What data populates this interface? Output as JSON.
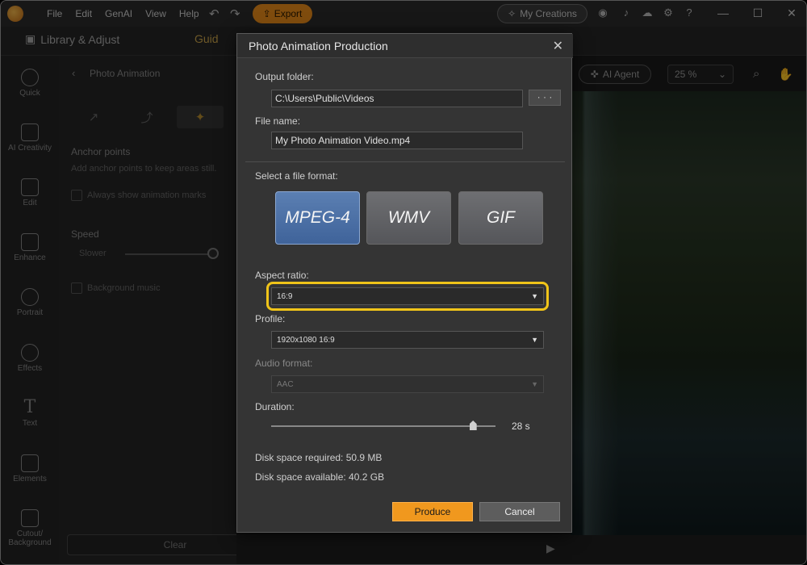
{
  "app": {
    "menu": [
      "File",
      "Edit",
      "GenAI",
      "View",
      "Help"
    ],
    "export_label": "Export",
    "my_creations_label": "My Creations",
    "library_tab": "Library & Adjust",
    "guide_tab": "Guid",
    "ai_agent_label": "AI Agent",
    "zoom_value": "25 %"
  },
  "sidebar": {
    "items": [
      {
        "label": "Quick",
        "icon": "magic-wand-icon"
      },
      {
        "label": "AI Creativity",
        "icon": "ai-creativity-icon"
      },
      {
        "label": "Edit",
        "icon": "edit-icon"
      },
      {
        "label": "Enhance",
        "icon": "enhance-icon"
      },
      {
        "label": "Portrait",
        "icon": "portrait-icon"
      },
      {
        "label": "Effects",
        "icon": "effects-icon"
      },
      {
        "label": "Text",
        "icon": "text-icon"
      },
      {
        "label": "Elements",
        "icon": "elements-icon"
      },
      {
        "label": "Cutout/",
        "label2": "Background",
        "icon": "cutout-icon"
      }
    ]
  },
  "panel": {
    "title": "Photo Animation",
    "anchor_heading": "Anchor points",
    "anchor_sub": "Add anchor points to keep areas still.",
    "always_show": "Always show animation marks",
    "speed_heading": "Speed",
    "speed_slower": "Slower",
    "bg_music": "Background music",
    "clear_label": "Clear"
  },
  "dialog": {
    "title": "Photo Animation Production",
    "output_folder_label": "Output folder:",
    "output_folder_value": "C:\\Users\\Public\\Videos",
    "browse_label": "· · ·",
    "file_name_label": "File name:",
    "file_name_value": "My Photo Animation Video.mp4",
    "format_label": "Select a file format:",
    "formats": [
      {
        "label": "MPEG-4",
        "selected": true
      },
      {
        "label": "WMV",
        "selected": false
      },
      {
        "label": "GIF",
        "selected": false
      }
    ],
    "aspect_ratio_label": "Aspect ratio:",
    "aspect_ratio_value": "16:9",
    "profile_label": "Profile:",
    "profile_value": "1920x1080 16:9",
    "audio_format_label": "Audio format:",
    "audio_format_value": "AAC",
    "duration_label": "Duration:",
    "duration_value": "28 s",
    "duration_fraction": 0.9,
    "disk_required": "Disk space required: 50.9 MB",
    "disk_available": "Disk space available: 40.2 GB",
    "produce_label": "Produce",
    "cancel_label": "Cancel"
  },
  "colors": {
    "accent": "#f0981e",
    "highlight": "#f0c419",
    "format_selected": "#4a6fa8"
  }
}
